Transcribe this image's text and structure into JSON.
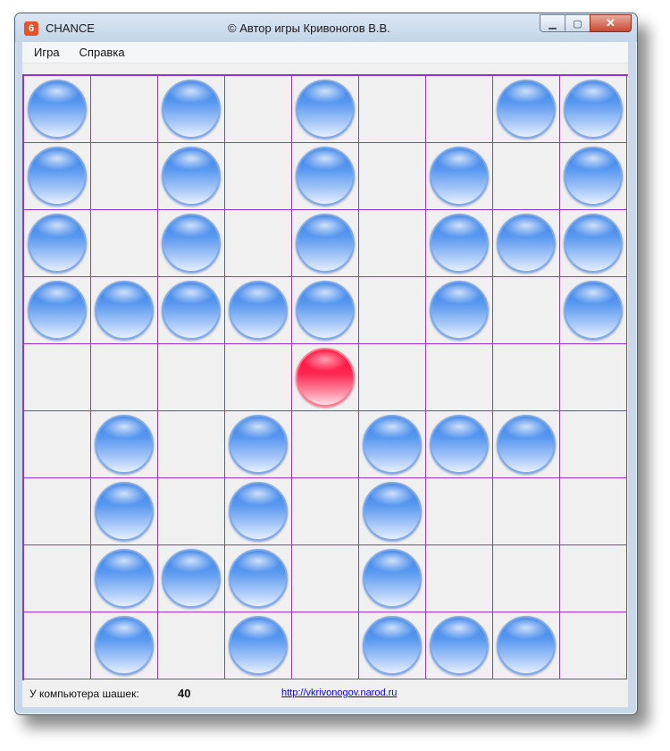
{
  "window": {
    "app_title": "CHANCE",
    "author": "©  Автор игры Кривоногов В.В.",
    "app_icon_glyph": "6",
    "minimize_glyph": "▁",
    "maximize_glyph": "▢",
    "close_glyph": "✕"
  },
  "menu": {
    "items": [
      "Игра",
      "Справка"
    ]
  },
  "board": {
    "size": 9,
    "grid_color": "#9933cc",
    "player_color": "#ff0030",
    "computer_color": "#2f7be6",
    "rows": [
      "B.B.B..BB",
      "B.B.B.B.B",
      "B.B.B.BBB",
      "BBBBB.B.B",
      "....R....",
      ".B.B.BBB.",
      ".B.B.B...",
      ".BBB.B...",
      ".B.B.BBB."
    ],
    "legend": {
      "B": "computer-checker",
      "R": "player-checker",
      ".": "empty"
    }
  },
  "status": {
    "label": "У компьютера шашек:",
    "count": "40",
    "link": "http://vkrivonogov.narod.ru"
  }
}
